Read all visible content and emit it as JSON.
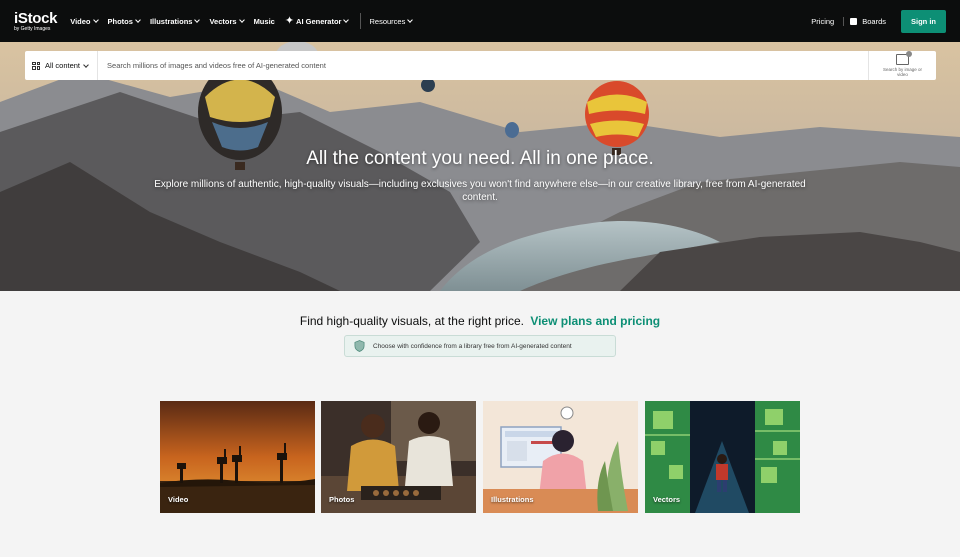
{
  "nav": {
    "logo": "iStock",
    "logo_sub": "by Getty Images",
    "items": [
      {
        "label": "Video"
      },
      {
        "label": "Photos"
      },
      {
        "label": "Illustrations"
      },
      {
        "label": "Vectors"
      },
      {
        "label": "Music"
      },
      {
        "label": "AI Generator"
      }
    ],
    "resources": "Resources",
    "pricing": "Pricing",
    "boards": "Boards",
    "signin": "Sign in"
  },
  "search": {
    "content_type": "All content",
    "placeholder": "Search millions of images and videos free of AI-generated content",
    "image_search_label": "Search by image or video"
  },
  "hero": {
    "title": "All the content you need. All in one place.",
    "subtitle": "Explore millions of authentic, high-quality visuals—including exclusives you won't find anywhere else—in our creative library, free from AI-generated content."
  },
  "pricing_section": {
    "text": "Find high-quality visuals, at the right price.",
    "link": "View plans and pricing",
    "badge": "Choose with confidence from a library free from AI-generated content"
  },
  "tiles": [
    {
      "label": "Video"
    },
    {
      "label": "Photos"
    },
    {
      "label": "Illustrations"
    },
    {
      "label": "Vectors"
    }
  ],
  "colors": {
    "accent": "#0d8f75",
    "nav_bg": "#0c0d0d",
    "page_bg": "#f4f4f4"
  }
}
